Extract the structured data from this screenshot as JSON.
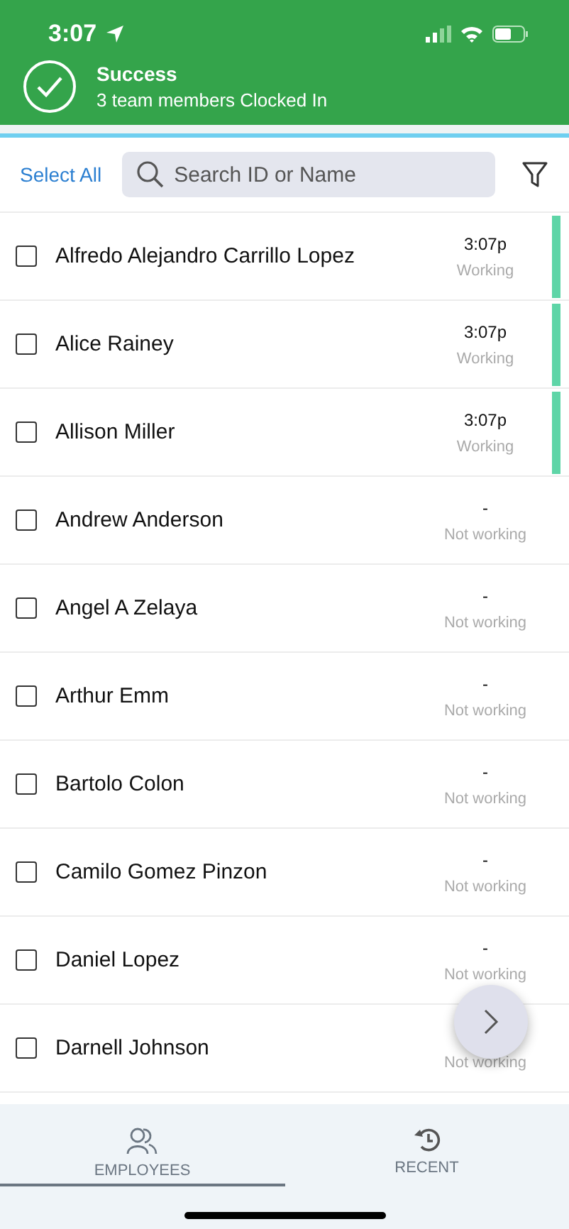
{
  "status_bar": {
    "time": "3:07"
  },
  "banner": {
    "title": "Success",
    "message": "3 team members Clocked In"
  },
  "toolbar": {
    "select_all": "Select All",
    "search": {
      "placeholder": "Search ID or Name"
    }
  },
  "employees": [
    {
      "name": "Alfredo Alejandro Carrillo Lopez",
      "time": "3:07p",
      "status": "Working",
      "working": true,
      "checked": false
    },
    {
      "name": "Alice Rainey",
      "time": "3:07p",
      "status": "Working",
      "working": true,
      "checked": false
    },
    {
      "name": "Allison Miller",
      "time": "3:07p",
      "status": "Working",
      "working": true,
      "checked": false
    },
    {
      "name": "Andrew Anderson",
      "time": "-",
      "status": "Not working",
      "working": false,
      "checked": false
    },
    {
      "name": "Angel A Zelaya",
      "time": "-",
      "status": "Not working",
      "working": false,
      "checked": false
    },
    {
      "name": "Arthur Emm",
      "time": "-",
      "status": "Not working",
      "working": false,
      "checked": false
    },
    {
      "name": "Bartolo Colon",
      "time": "-",
      "status": "Not working",
      "working": false,
      "checked": false
    },
    {
      "name": "Camilo Gomez Pinzon",
      "time": "-",
      "status": "Not working",
      "working": false,
      "checked": false
    },
    {
      "name": "Daniel Lopez",
      "time": "-",
      "status": "Not working",
      "working": false,
      "checked": false
    },
    {
      "name": "Darnell Johnson",
      "status": "Not working",
      "working": false,
      "checked": false
    }
  ],
  "tabs": [
    {
      "label": "EMPLOYEES",
      "selected": true
    },
    {
      "label": "RECENT",
      "selected": false
    }
  ]
}
